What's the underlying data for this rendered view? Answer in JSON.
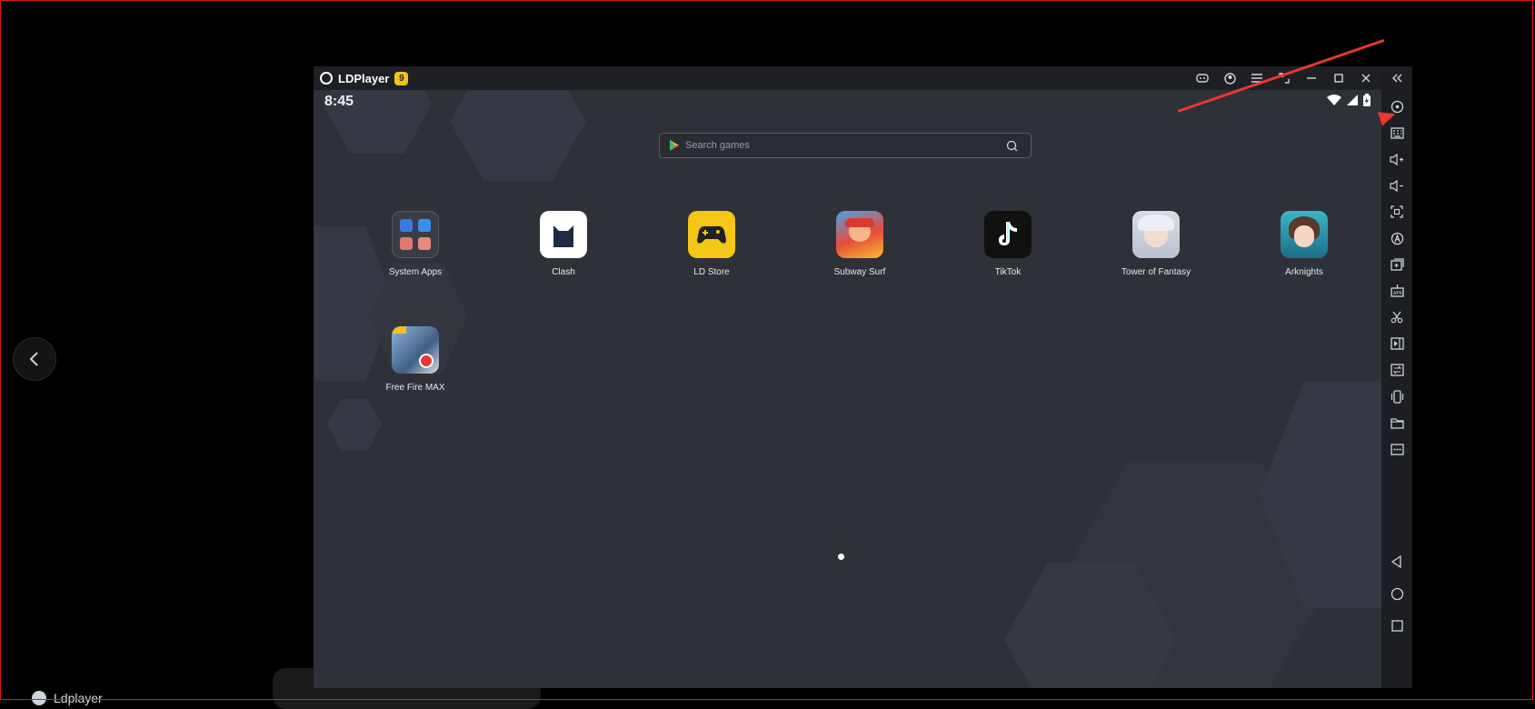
{
  "window": {
    "title": "LDPlayer",
    "badge": "9"
  },
  "status_bar": {
    "time": "8:45"
  },
  "search": {
    "placeholder": "Search games"
  },
  "apps": [
    {
      "label": "System Apps",
      "icon": "folder-icon"
    },
    {
      "label": "Clash",
      "icon": "cat-icon"
    },
    {
      "label": "LD Store",
      "icon": "gamepad-icon"
    },
    {
      "label": "Subway Surf",
      "icon": "subway-surf-icon"
    },
    {
      "label": "TikTok",
      "icon": "tiktok-icon"
    },
    {
      "label": "Tower of Fantasy",
      "icon": "tower-of-fantasy-icon"
    },
    {
      "label": "Arknights",
      "icon": "arknights-icon"
    },
    {
      "label": "Free Fire MAX",
      "icon": "free-fire-icon"
    }
  ],
  "taskbar": {
    "label": "Ldplayer"
  },
  "colors": {
    "background": "#2f3139",
    "sidebar": "#1d1e23",
    "accent_arrow": "#e8382e",
    "badge": "#f2c21a"
  }
}
